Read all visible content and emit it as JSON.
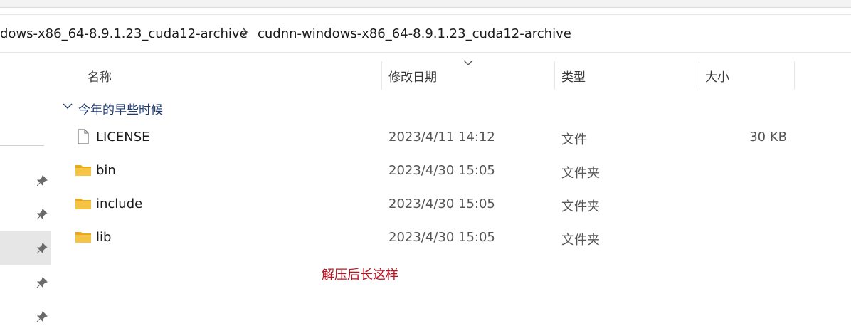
{
  "breadcrumb": {
    "parent": "dows-x86_64-8.9.1.23_cuda12-archive",
    "current": "cudnn-windows-x86_64-8.9.1.23_cuda12-archive"
  },
  "columns": {
    "name": "名称",
    "date": "修改日期",
    "type": "类型",
    "size": "大小"
  },
  "group": {
    "label": "今年的早些时候"
  },
  "files": [
    {
      "name": "LICENSE",
      "date": "2023/4/11 14:12",
      "type": "文件",
      "size": "30 KB",
      "icon": "file-icon"
    },
    {
      "name": "bin",
      "date": "2023/4/30 15:05",
      "type": "文件夹",
      "size": "",
      "icon": "folder-icon"
    },
    {
      "name": "include",
      "date": "2023/4/30 15:05",
      "type": "文件夹",
      "size": "",
      "icon": "folder-icon"
    },
    {
      "name": "lib",
      "date": "2023/4/30 15:05",
      "type": "文件夹",
      "size": "",
      "icon": "folder-icon"
    }
  ],
  "annotation": "解压后长这样",
  "colors": {
    "annotation": "#c0111f",
    "folder": "#f6c445",
    "group_label": "#1e3a70"
  }
}
